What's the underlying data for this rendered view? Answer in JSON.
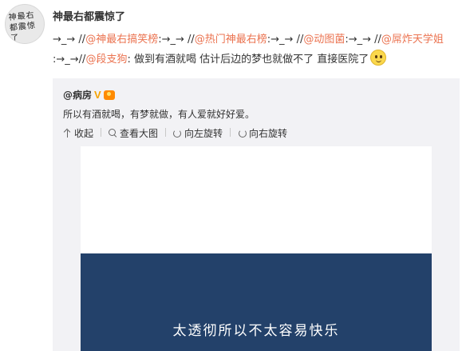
{
  "author": {
    "avatar_text": "神最右 都震惊了",
    "name": "神最右都震惊了"
  },
  "post": {
    "segments": [
      {
        "text": "→_→ //",
        "type": "plain"
      },
      {
        "text": "@神最右搞笑榜",
        "type": "mention"
      },
      {
        "text": ":→_→ //",
        "type": "plain"
      },
      {
        "text": "@热门神最右榜",
        "type": "mention"
      },
      {
        "text": ":→_→ //",
        "type": "plain"
      },
      {
        "text": "@动图菌",
        "type": "mention"
      },
      {
        "text": ":→_→ //",
        "type": "plain"
      },
      {
        "text": "@屌炸天学姐",
        "type": "mention"
      },
      {
        "text": " :→_→//",
        "type": "plain"
      },
      {
        "text": "@段支狗",
        "type": "mention"
      },
      {
        "text": ": 做到有酒就喝 估计后边的梦也就做不了 直接医院了",
        "type": "plain"
      }
    ],
    "emoji_icon": "grinning-face-icon"
  },
  "repost": {
    "author": "@病房",
    "verified_icon": "verified-v-icon",
    "vip_icon": "vip-crown-icon",
    "text": "所以有酒就喝，有梦就做，有人爱就好好爱。",
    "toolbar": {
      "collapse_label": "收起",
      "view_large_label": "查看大图",
      "rotate_left_label": "向左旋转",
      "rotate_right_label": "向右旋转"
    },
    "image_caption": "太透彻所以不太容易快乐"
  },
  "colors": {
    "mention": "#eb7350",
    "repost_bg": "#f2f2f5",
    "image_dark": "#23416a"
  }
}
